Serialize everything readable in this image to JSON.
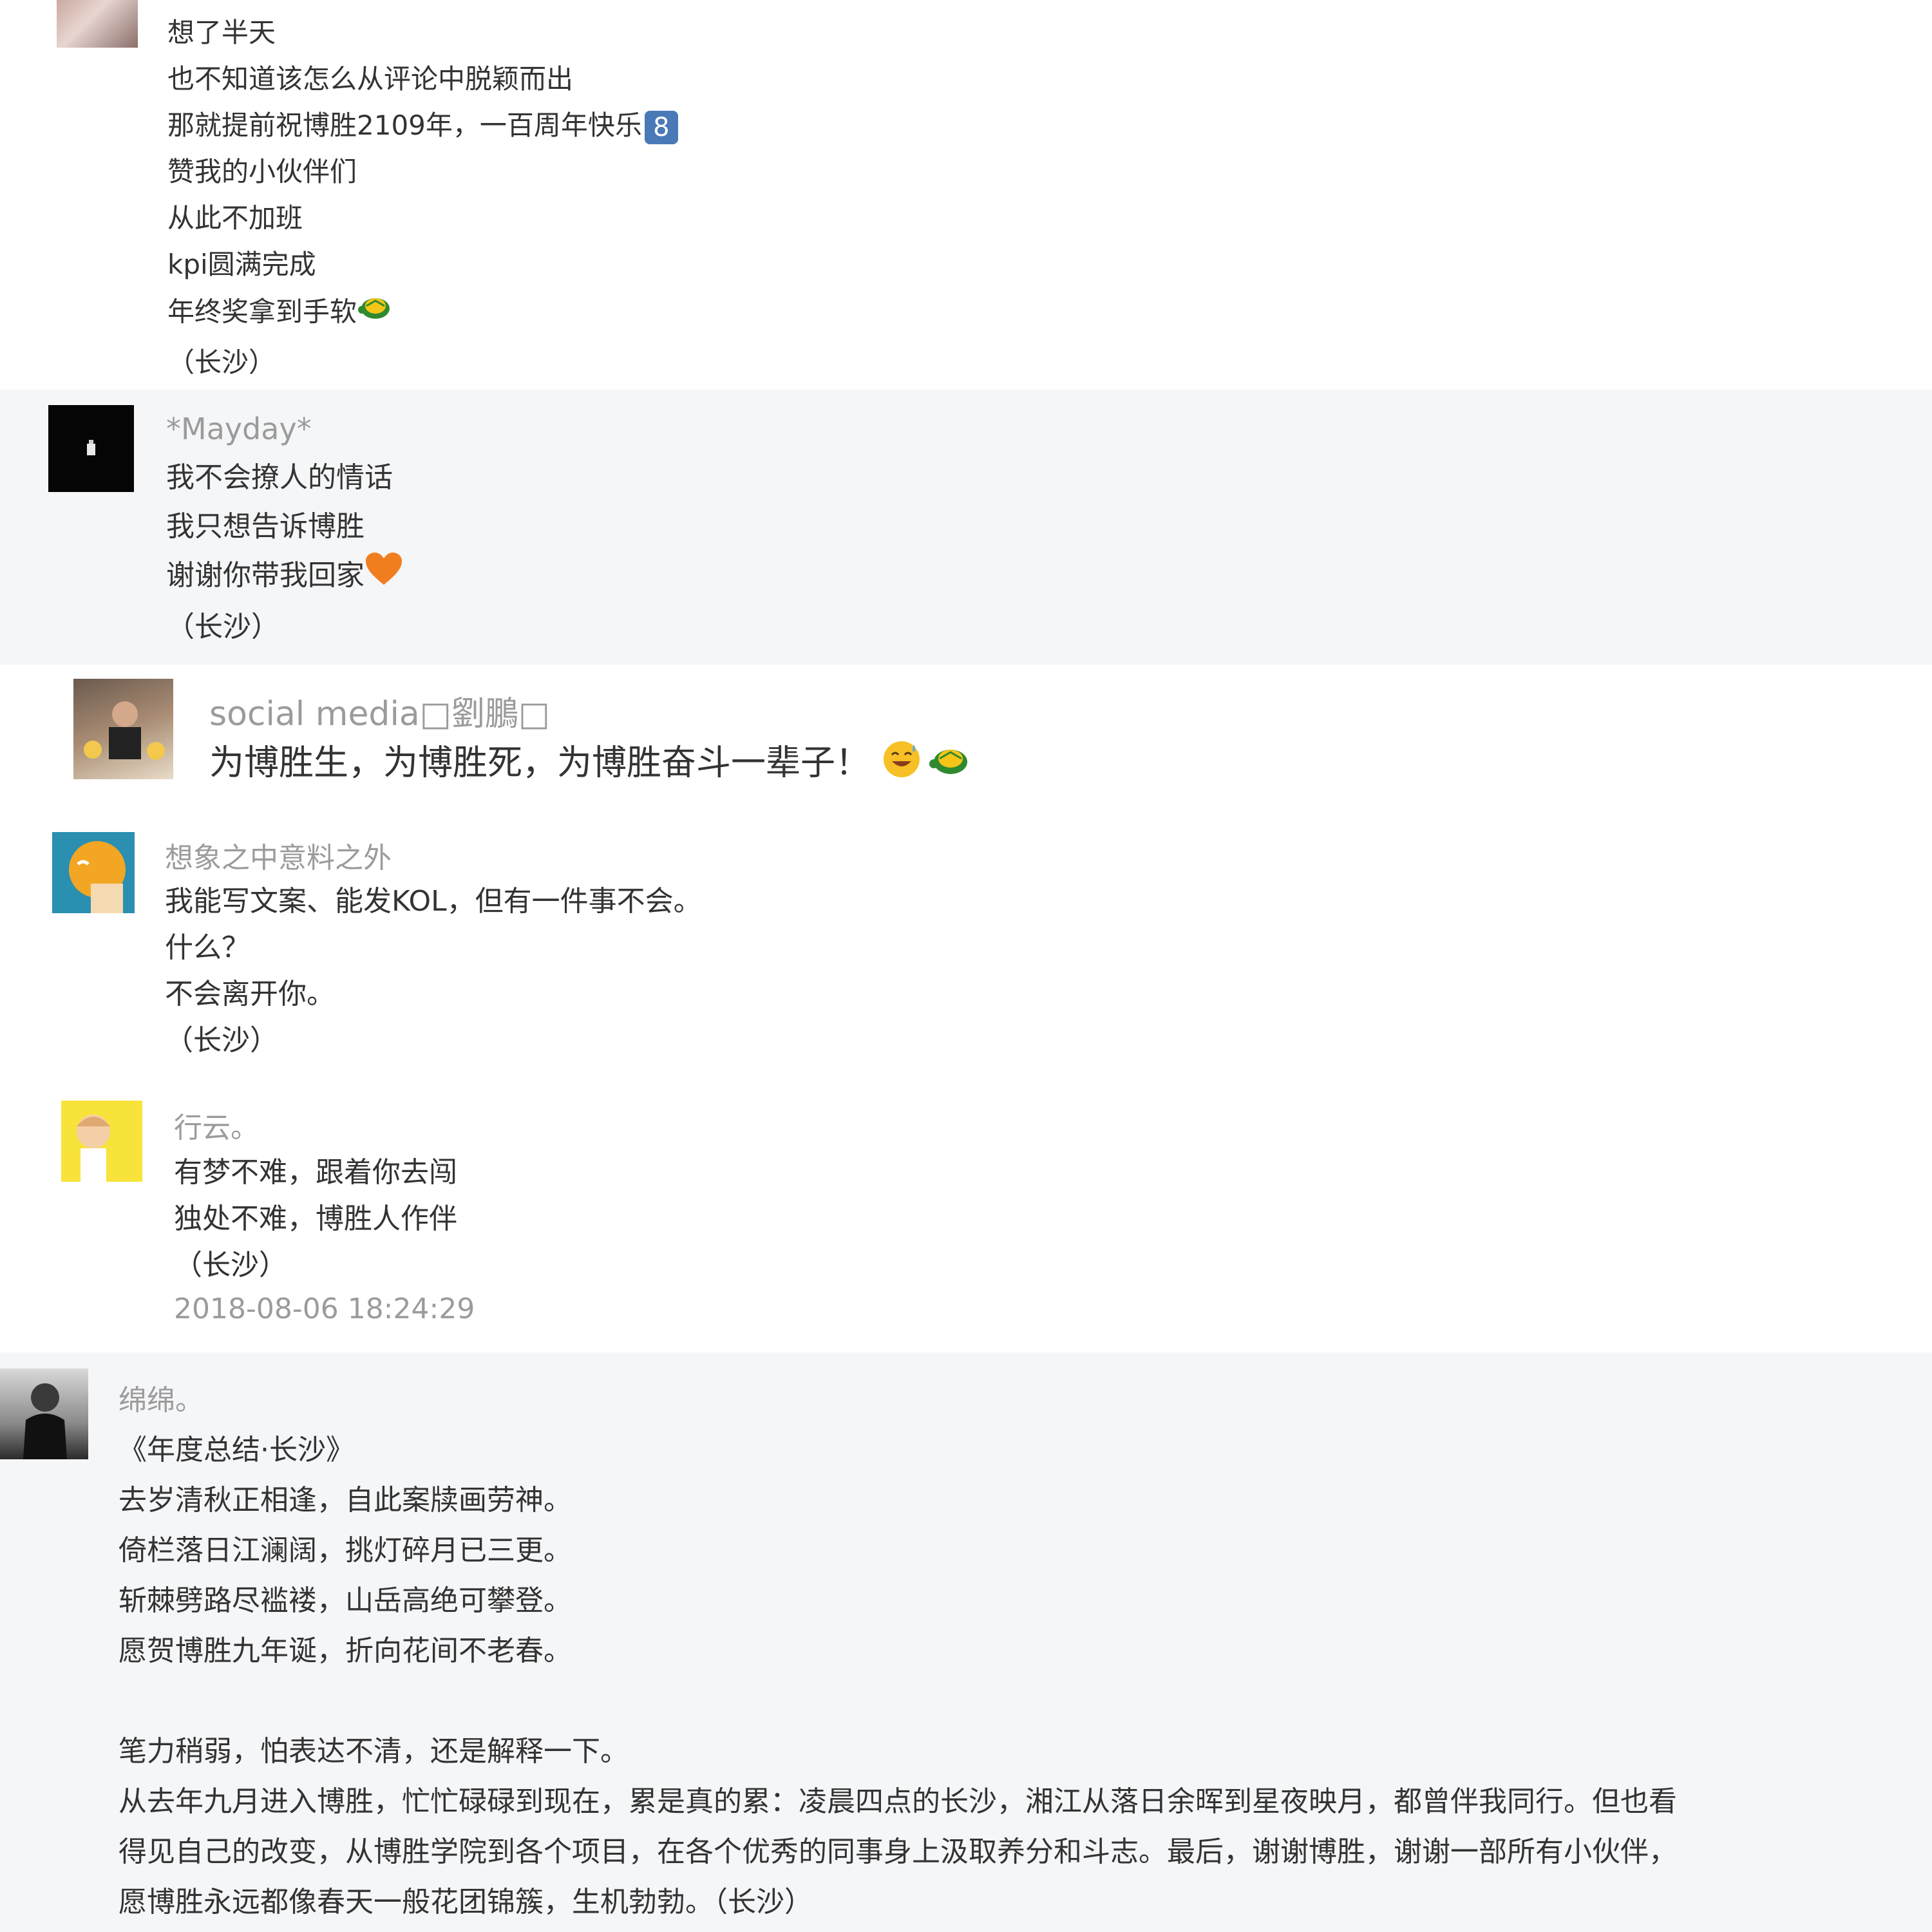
{
  "comments": [
    {
      "lines": [
        "想了半天",
        "也不知道该怎么从评论中脱颖而出",
        "那就提前祝博胜2109年，一百周年快乐",
        "赞我的小伙伴们",
        "从此不加班",
        "kpi圆满完成",
        "年终奖拿到手软",
        "（长沙）"
      ],
      "keycap": "8"
    },
    {
      "name": "*Mayday*",
      "lines": [
        "我不会撩人的情话",
        "我只想告诉博胜",
        "谢谢你带我回家",
        "（长沙）"
      ]
    },
    {
      "name": "social media□劉鵬□",
      "lines": [
        "为博胜生，为博胜死，为博胜奋斗一辈子！"
      ]
    },
    {
      "name": "想象之中意料之外",
      "lines": [
        "我能写文案、能发KOL，但有一件事不会。",
        "什么？",
        "不会离开你。",
        "（长沙）"
      ]
    },
    {
      "name": "行云。",
      "lines": [
        "有梦不难，跟着你去闯",
        "独处不难，博胜人作伴",
        "（长沙）"
      ],
      "date": "2018-08-06 18:24:29"
    },
    {
      "name": "绵绵。",
      "lines": [
        "《年度总结·长沙》",
        "去岁清秋正相逢，自此案牍画劳神。",
        "倚栏落日江澜阔，挑灯碎月已三更。",
        "斩棘劈路尽褴褛，山岳高绝可攀登。",
        "愿贺博胜九年诞，折向花间不老春。",
        "",
        "笔力稍弱，怕表达不清，还是解释一下。",
        "从去年九月进入博胜，忙忙碌碌到现在，累是真的累：凌晨四点的长沙，湘江从落日余晖到星夜映月，都曾伴我同行。但也看",
        "得见自己的改变，从博胜学院到各个项目，在各个优秀的同事身上汲取养分和斗志。最后，谢谢博胜，谢谢一部所有小伙伴，",
        "愿博胜永远都像春天一般花团锦簇，生机勃勃。（长沙）"
      ]
    }
  ],
  "icons": {
    "turtle": "turtle-emoji-icon",
    "heart": "orange-heart-emoji-icon",
    "grin": "grinning-sweat-emoji-icon"
  },
  "colors": {
    "gray_background": "#f5f6f8",
    "name_text": "#9b9b9b",
    "body_text": "#333333",
    "keycap": "#4a79b8"
  }
}
